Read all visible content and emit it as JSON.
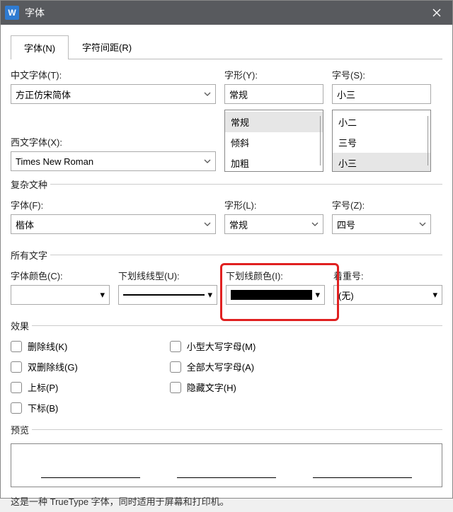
{
  "title": "字体",
  "tabs": {
    "font": "字体(N)",
    "spacing": "字符间距(R)"
  },
  "labels": {
    "cn_font": "中文字体(T):",
    "style": "字形(Y):",
    "size": "字号(S):",
    "west_font": "西文字体(X):",
    "complex_group": "复杂文种",
    "cfont": "字体(F):",
    "cstyle": "字形(L):",
    "csize": "字号(Z):",
    "all_text_group": "所有文字",
    "font_color": "字体颜色(C):",
    "underline_style": "下划线线型(U):",
    "underline_color": "下划线颜色(I):",
    "emphasis": "着重号:",
    "effects_group": "效果",
    "preview_group": "预览"
  },
  "values": {
    "cn_font": "方正仿宋简体",
    "style": "常规",
    "size": "小三",
    "west_font": "Times New Roman",
    "cfont": "楷体",
    "cstyle": "常规",
    "csize": "四号",
    "emphasis": "(无)"
  },
  "style_options": [
    "常规",
    "倾斜",
    "加粗"
  ],
  "size_options": [
    "小二",
    "三号",
    "小三"
  ],
  "style_selected_index": 0,
  "size_selected_index": 2,
  "effects": {
    "strike": "删除线(K)",
    "dstrike": "双删除线(G)",
    "super": "上标(P)",
    "sub": "下标(B)",
    "smallcaps": "小型大写字母(M)",
    "allcaps": "全部大写字母(A)",
    "hidden": "隐藏文字(H)"
  },
  "footer": "这是一种 TrueType 字体，同时适用于屏幕和打印机。"
}
